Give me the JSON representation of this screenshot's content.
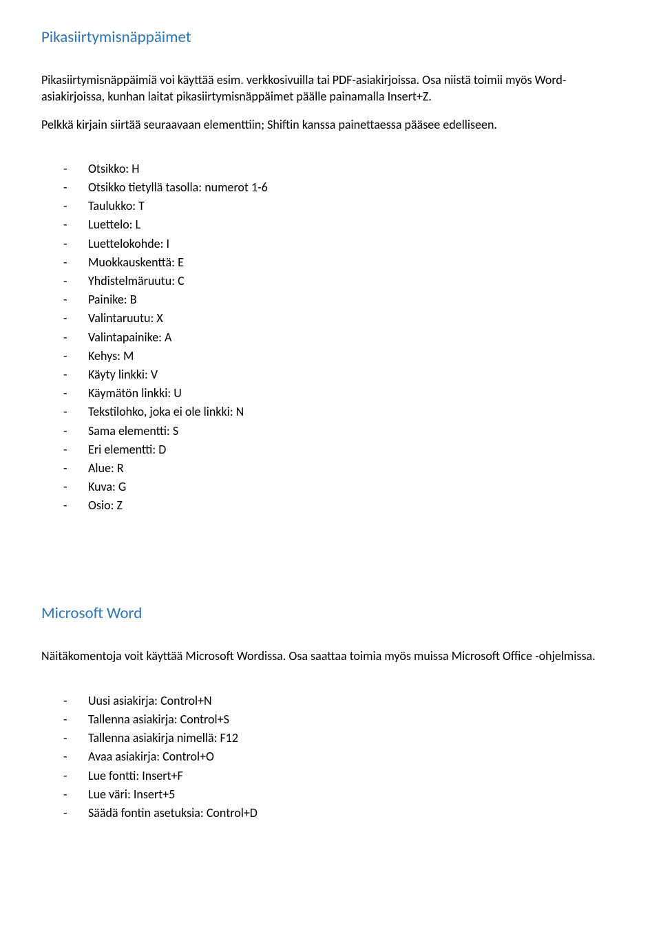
{
  "section1": {
    "heading": "Pikasiirtymisnäppäimet",
    "p1": "Pikasiirtymisnäppäimiä voi käyttää esim. verkkosivuilla tai PDF-asiakirjoissa. Osa niistä toimii myös Word-asiakirjoissa, kunhan laitat pikasiirtymisnäppäimet päälle painamalla Insert+Z.",
    "p2": "Pelkkä kirjain siirtää seuraavaan elementtiin; Shiftin kanssa painettaessa pääsee edelliseen.",
    "items": [
      "Otsikko: H",
      "Otsikko tietyllä tasolla: numerot 1-6",
      "Taulukko: T",
      "Luettelo: L",
      "Luettelokohde: I",
      "Muokkauskenttä: E",
      "Yhdistelmäruutu: C",
      "Painike: B",
      "Valintaruutu: X",
      "Valintapainike: A",
      "Kehys: M",
      "Käyty linkki: V",
      "Käymätön linkki: U",
      "Tekstilohko, joka ei ole linkki: N",
      "Sama elementti: S",
      "Eri elementti: D",
      "Alue: R",
      "Kuva: G",
      "Osio: Z"
    ]
  },
  "section2": {
    "heading": "Microsoft Word",
    "p1": "Näitäkomentoja voit käyttää Microsoft Wordissa. Osa saattaa toimia myös muissa Microsoft Office -ohjelmissa.",
    "items": [
      "Uusi asiakirja: Control+N",
      "Tallenna asiakirja: Control+S",
      "Tallenna asiakirja nimellä: F12",
      "Avaa asiakirja: Control+O",
      "Lue fontti: Insert+F",
      "Lue väri: Insert+5",
      "Säädä fontin asetuksia: Control+D"
    ]
  }
}
